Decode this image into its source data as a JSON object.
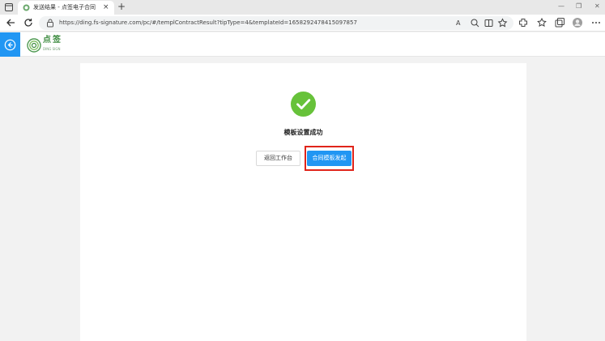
{
  "browser": {
    "tab_title": "发送结果 - 点签电子合同",
    "tab_close": "×",
    "new_tab": "+",
    "window_controls": [
      "—",
      "❐",
      "✕"
    ],
    "url": "https://ding.fs-signature.com/pc/#/templContractResult?tipType=4&templateId=1658292478415097857",
    "read_aloud": "A",
    "icons": [
      "back-icon",
      "refresh-icon",
      "lock-icon",
      "read-aloud-icon",
      "zoom-icon",
      "split-screen-icon",
      "favorites-add-icon",
      "extensions-icon",
      "favorites-icon",
      "collections-icon",
      "profile-icon",
      "more-icon"
    ]
  },
  "app": {
    "logo_title": "点签",
    "logo_subtitle": "DING SIGN",
    "brand_color": "#3b8a3e",
    "accent_color": "#2196f3"
  },
  "result": {
    "title": "模板设置成功",
    "return_button": "返回工作台",
    "dispatch_button": "合同模板发起",
    "success_color": "#67c23a",
    "highlight_color": "#e0241a"
  }
}
